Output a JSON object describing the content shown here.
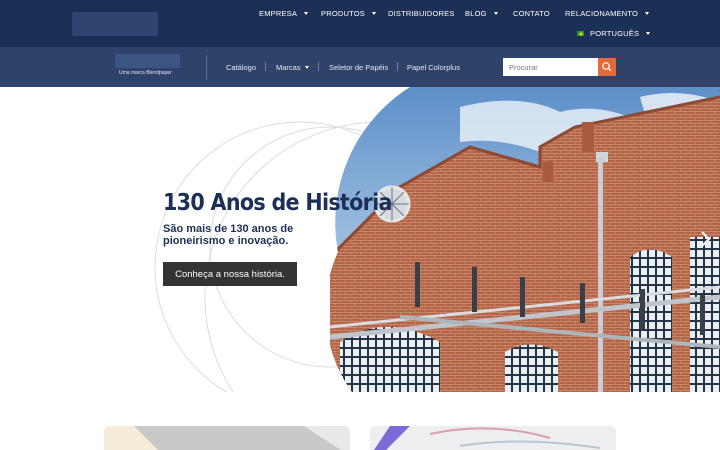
{
  "topnav": {
    "items": [
      {
        "label": "EMPRESA",
        "dropdown": true
      },
      {
        "label": "PRODUTOS",
        "dropdown": true
      },
      {
        "label": "DISTRIBUIDORES",
        "dropdown": false
      },
      {
        "label": "BLOG",
        "dropdown": true
      },
      {
        "label": "CONTATO",
        "dropdown": false
      },
      {
        "label": "RELACIONAMENTO",
        "dropdown": true
      }
    ],
    "language": "PORTUGUÊS"
  },
  "subnav": {
    "logo_tagline": "Uma marca Blendpaper",
    "items": [
      {
        "label": "Catálogo",
        "dropdown": false
      },
      {
        "label": "Marcas",
        "dropdown": true
      },
      {
        "label": "Seletor de Papéis",
        "dropdown": false
      },
      {
        "label": "Papel Colorplus",
        "dropdown": false
      }
    ],
    "search_placeholder": "Procurar"
  },
  "hero": {
    "title": "130 Anos de História",
    "subtitle": "São mais de 130 anos de pioneirismo e inovação.",
    "button": "Conheça a nossa história."
  },
  "colors": {
    "navy": "#1c2f55",
    "subbar": "#2e426a",
    "accent": "#e26b3c",
    "button": "#333333"
  },
  "icons": [
    "caret-down-icon",
    "brazil-flag-icon",
    "search-icon",
    "chevron-right-icon"
  ]
}
